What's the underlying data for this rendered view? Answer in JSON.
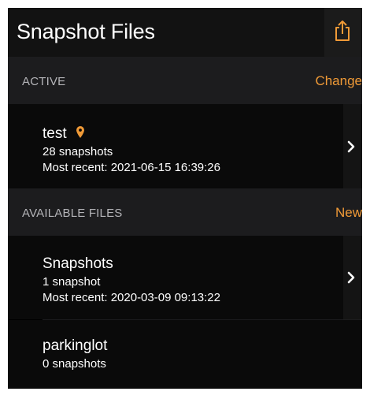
{
  "nav": {
    "title": "Snapshot Files",
    "share_icon": "share-icon"
  },
  "colors": {
    "accent": "#f09a37",
    "background": "#000000",
    "section_bg": "#1c1c1e"
  },
  "active_section": {
    "title": "ACTIVE",
    "action": "Change",
    "file": {
      "name": "test",
      "pin_icon": "location-pin-icon",
      "count": "28 snapshots",
      "recent": "Most recent: 2021-06-15 16:39:26"
    }
  },
  "available_section": {
    "title": "AVAILABLE FILES",
    "action": "New",
    "files": [
      {
        "name": "Snapshots",
        "count": "1 snapshot",
        "recent": "Most recent: 2020-03-09 09:13:22"
      },
      {
        "name": "parkinglot",
        "count": "0 snapshots"
      }
    ]
  }
}
